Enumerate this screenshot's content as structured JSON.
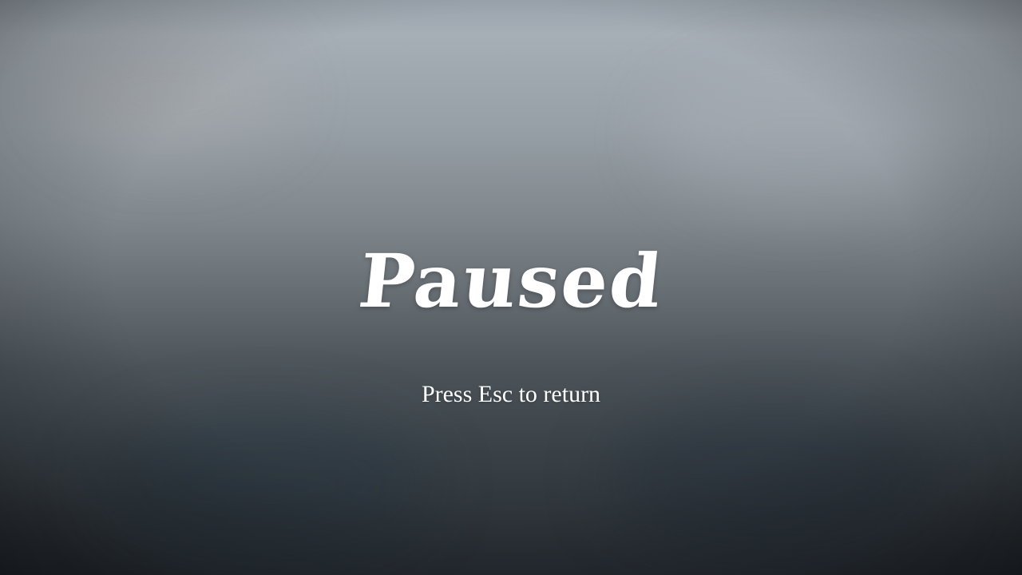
{
  "pause_menu": {
    "title": "Paused",
    "hint": "Press Esc to return"
  },
  "colors": {
    "background_top": "#a6aeb6",
    "background_bottom": "#252b31",
    "text": "#ffffff"
  }
}
